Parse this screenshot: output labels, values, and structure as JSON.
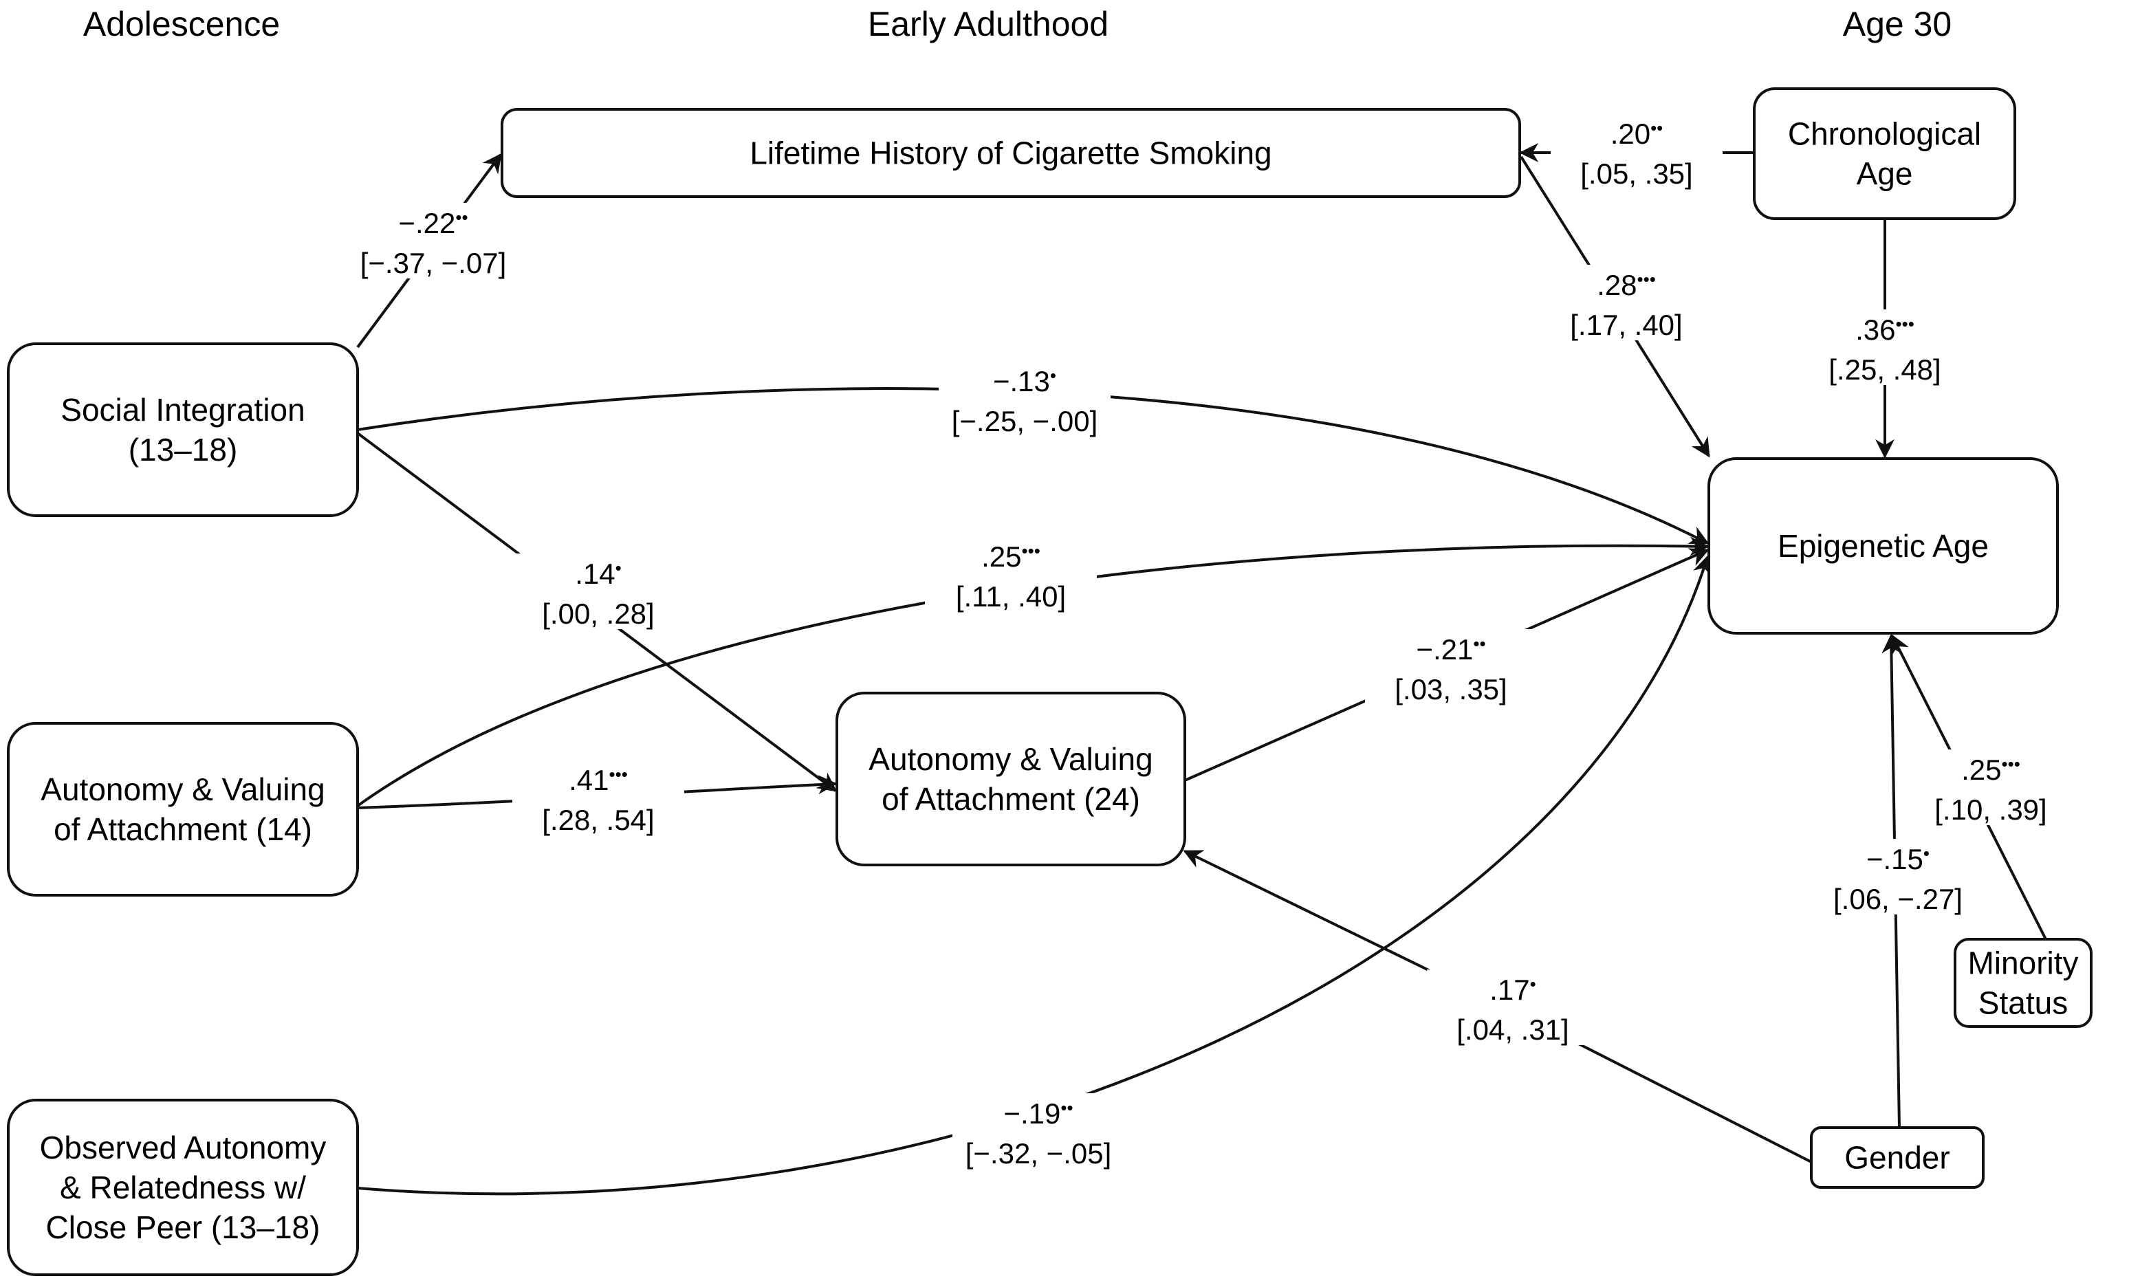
{
  "headers": {
    "adolescence": "Adolescence",
    "early_adulthood": "Early Adulthood",
    "age30": "Age 30"
  },
  "nodes": {
    "smoking": {
      "lines": [
        "Lifetime History of Cigarette Smoking"
      ]
    },
    "chron_age": {
      "lines": [
        "Chronological",
        "Age"
      ]
    },
    "social_integration": {
      "lines": [
        "Social Integration",
        "(13–18)"
      ]
    },
    "epigenetic_age": {
      "lines": [
        "Epigenetic Age"
      ]
    },
    "ava14": {
      "lines": [
        "Autonomy & Valuing",
        "of Attachment (14)"
      ]
    },
    "ava24": {
      "lines": [
        "Autonomy & Valuing",
        "of Attachment (24)"
      ]
    },
    "observed": {
      "lines": [
        "Observed Autonomy",
        "& Relatedness  w/",
        "Close Peer (13–18)"
      ]
    },
    "minority": {
      "lines": [
        "Minority",
        "Status"
      ]
    },
    "gender": {
      "lines": [
        "Gender"
      ]
    }
  },
  "edges": [
    {
      "id": "si_smoking",
      "from": "social_integration",
      "to": "smoking",
      "coef": "−.22",
      "stars": "**",
      "ci": "[−.37, −.07]"
    },
    {
      "id": "chron_smoking",
      "from": "chron_age",
      "to": "smoking",
      "coef": ".20",
      "stars": "**",
      "ci": "[.05, .35]"
    },
    {
      "id": "smoking_epi",
      "from": "smoking",
      "to": "epigenetic_age",
      "coef": ".28",
      "stars": "***",
      "ci": "[.17, .40]"
    },
    {
      "id": "chron_epi",
      "from": "chron_age",
      "to": "epigenetic_age",
      "coef": ".36",
      "stars": "***",
      "ci": "[.25, .48]"
    },
    {
      "id": "si_epi",
      "from": "social_integration",
      "to": "epigenetic_age",
      "coef": "−.13",
      "stars": "*",
      "ci": "[−.25, −.00]"
    },
    {
      "id": "si_ava24",
      "from": "social_integration",
      "to": "ava24",
      "coef": ".14",
      "stars": "*",
      "ci": "[.00, .28]"
    },
    {
      "id": "ava14_epi",
      "from": "ava14",
      "to": "epigenetic_age",
      "coef": ".25",
      "stars": "***",
      "ci": "[.11, .40]"
    },
    {
      "id": "ava14_ava24",
      "from": "ava14",
      "to": "ava24",
      "coef": ".41",
      "stars": "***",
      "ci": "[.28, .54]"
    },
    {
      "id": "ava24_epi",
      "from": "ava24",
      "to": "epigenetic_age",
      "coef": "−.21",
      "stars": "**",
      "ci": "[.03, .35]"
    },
    {
      "id": "gender_ava24",
      "from": "gender",
      "to": "ava24",
      "coef": ".17",
      "stars": "*",
      "ci": "[.04, .31]"
    },
    {
      "id": "observed_epi",
      "from": "observed",
      "to": "epigenetic_age",
      "coef": "−.19",
      "stars": "**",
      "ci": "[−.32, −.05]"
    },
    {
      "id": "gender_epi",
      "from": "gender",
      "to": "epigenetic_age",
      "coef": "−.15",
      "stars": "*",
      "ci": "[.06, −.27]"
    },
    {
      "id": "minority_epi",
      "from": "minority",
      "to": "epigenetic_age",
      "coef": ".25",
      "stars": "***",
      "ci": "[.10, .39]"
    }
  ]
}
